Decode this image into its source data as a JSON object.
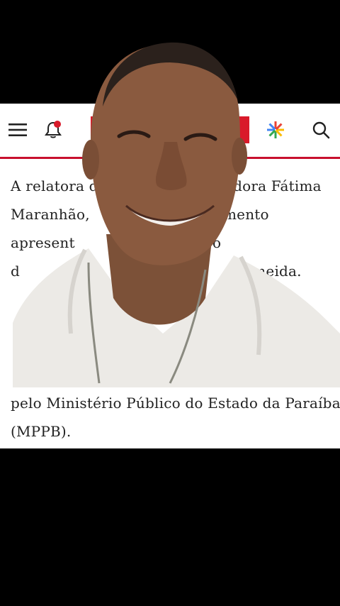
{
  "header": {
    "menu_icon": "hamburger-menu-icon",
    "bell_icon": "notification-bell-icon",
    "star_icon": "google-star-icon",
    "search_icon": "search-icon",
    "accent": "#c8102e",
    "logo_color": "#d91a2a"
  },
  "article": {
    "p1_lines": [
      "A relatora d",
      "adora Fátima",
      "Maranhão, ",
      "mento",
      "apresent",
      "o",
      "d",
      "Almeida."
    ],
    "p2_lines": [
      "pelo Ministério Público do Estado da Paraíba",
      "(MPPB)."
    ]
  },
  "overlay": {
    "subject": "person-selfie-cutout"
  }
}
